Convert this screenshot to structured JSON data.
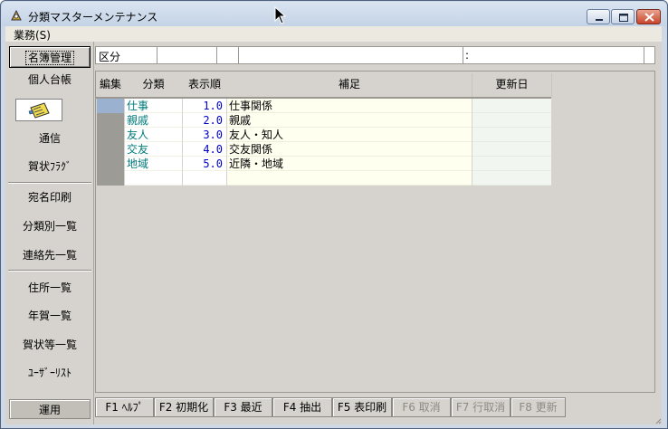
{
  "window": {
    "title": "分類マスターメンテナンス"
  },
  "menu": {
    "items": [
      {
        "label": "業務(S)"
      }
    ]
  },
  "nav": {
    "items": [
      {
        "label": "名簿管理",
        "active": true
      },
      {
        "label": "個人台帳"
      },
      {
        "label": "",
        "icon": "classification-image-icon",
        "selected": true
      },
      {
        "label": "通信"
      },
      {
        "label": "賀状ﾌﾗｸﾞ"
      },
      {
        "label": "宛名印刷"
      },
      {
        "label": "分類別一覧"
      },
      {
        "label": "連絡先一覧"
      },
      {
        "label": "住所一覧"
      },
      {
        "label": "年賀一覧"
      },
      {
        "label": "賀状等一覧"
      },
      {
        "label": "ﾕｰｻﾞｰﾘｽﾄ"
      }
    ],
    "footer": "運用"
  },
  "kubun": {
    "label": "区分",
    "colon": ":"
  },
  "grid": {
    "headers": {
      "edit": "編集",
      "name": "分類",
      "order": "表示順",
      "note": "補足",
      "date": "更新日"
    },
    "rows": [
      {
        "name": "仕事",
        "order": "1.0",
        "note": "仕事関係",
        "date": ""
      },
      {
        "name": "親戚",
        "order": "2.0",
        "note": "親戚",
        "date": ""
      },
      {
        "name": "友人",
        "order": "3.0",
        "note": "友人・知人",
        "date": ""
      },
      {
        "name": "交友",
        "order": "4.0",
        "note": "交友関係",
        "date": ""
      },
      {
        "name": "地域",
        "order": "5.0",
        "note": "近隣・地域",
        "date": ""
      },
      {
        "name": "",
        "order": "",
        "note": "",
        "date": ""
      }
    ]
  },
  "fkeys": [
    {
      "label": "F1 ﾍﾙﾌﾟ",
      "enabled": true
    },
    {
      "label": "F2 初期化",
      "enabled": true
    },
    {
      "label": "F3 最近",
      "enabled": true
    },
    {
      "label": "F4 抽出",
      "enabled": true
    },
    {
      "label": "F5 表印刷",
      "enabled": true
    },
    {
      "label": "F6 取消",
      "enabled": false
    },
    {
      "label": "F7 行取消",
      "enabled": false
    },
    {
      "label": "F8 更新",
      "enabled": false
    }
  ],
  "colors": {
    "name_text": "#007b7b",
    "order_text": "#0000cc",
    "edit_selected": "#9ab1d0"
  }
}
